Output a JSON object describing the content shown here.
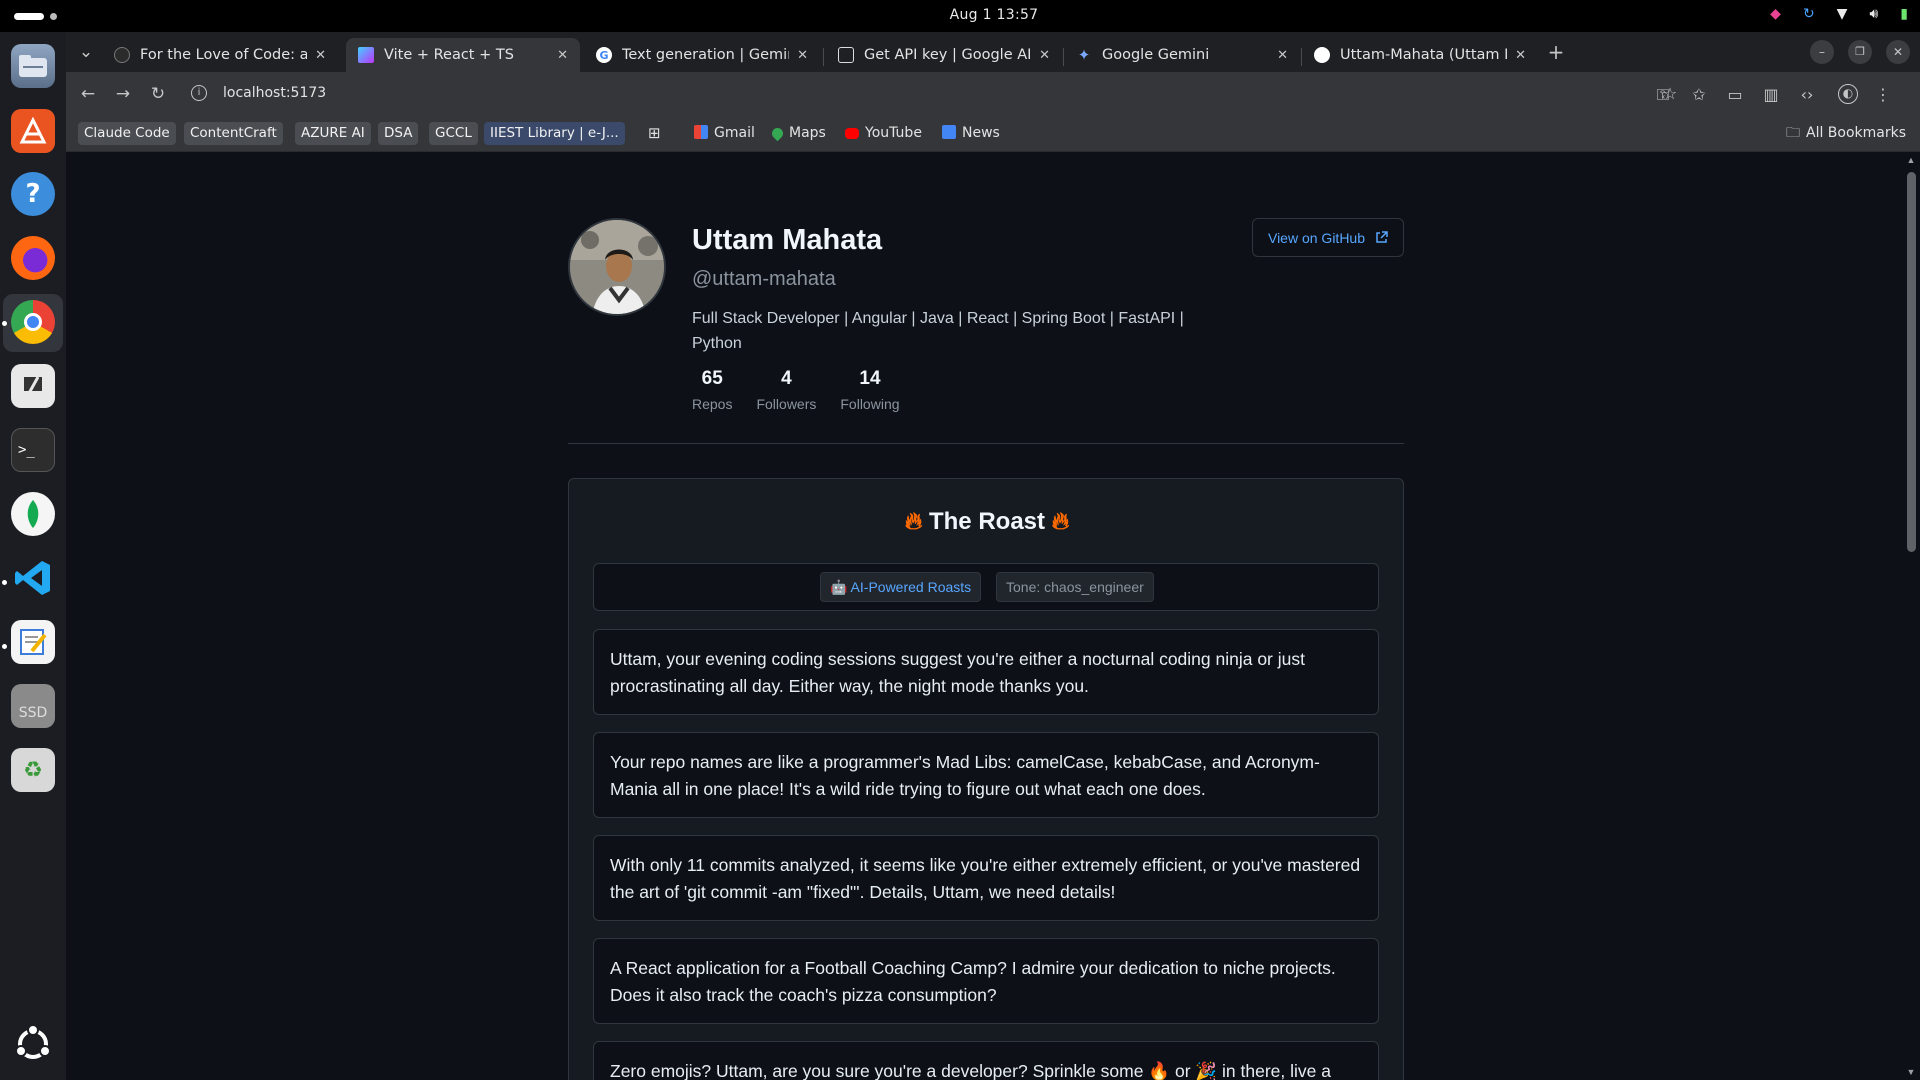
{
  "system": {
    "clock": "Aug 1  13:57"
  },
  "tabs": [
    {
      "title": "For the Love of Code: a s",
      "icon": "github-icon"
    },
    {
      "title": "Vite + React + TS",
      "icon": "vite-icon",
      "active": true
    },
    {
      "title": "Text generation  |  Gemin",
      "icon": "google-icon"
    },
    {
      "title": "Get API key | Google AI S",
      "icon": "ai-studio-icon"
    },
    {
      "title": "Google Gemini",
      "icon": "gemini-icon"
    },
    {
      "title": "Uttam-Mahata (Uttam M",
      "icon": "github-icon"
    }
  ],
  "address": {
    "url": "localhost:5173"
  },
  "bookmarks": {
    "chips": [
      "Claude Code",
      "ContentCraft",
      "AZURE AI",
      "DSA",
      "GCCL",
      "IIEST Library | e-J..."
    ],
    "links": [
      "Gmail",
      "Maps",
      "YouTube",
      "News"
    ],
    "all": "All Bookmarks"
  },
  "profile": {
    "name": "Uttam Mahata",
    "username": "@uttam-mahata",
    "bio": "Full Stack Developer | Angular | Java | React | Spring Boot | FastAPI | Python",
    "github_button": "View on GitHub",
    "stats": [
      {
        "value": "65",
        "label": "Repos"
      },
      {
        "value": "4",
        "label": "Followers"
      },
      {
        "value": "14",
        "label": "Following"
      }
    ]
  },
  "roast": {
    "title": "The Roast",
    "badge_ai": "🤖 AI-Powered Roasts",
    "badge_tone": "Tone: chaos_engineer",
    "items": [
      "Uttam, your evening coding sessions suggest you're either a nocturnal coding ninja or just procrastinating all day. Either way, the night mode thanks you.",
      "Your repo names are like a programmer's Mad Libs: camelCase, kebabCase, and Acronym-Mania all in one place! It's a wild ride trying to figure out what each one does.",
      "With only 11 commits analyzed, it seems like you're either extremely efficient, or you've mastered the art of 'git commit -am \"fixed\"'. Details, Uttam, we need details!",
      "A React application for a Football Coaching Camp? I admire your dedication to niche projects. Does it also track the coach's pizza consumption?",
      "Zero emojis? Uttam, are you sure you're a developer? Sprinkle some 🔥 or 🎉 in there, live a"
    ]
  }
}
